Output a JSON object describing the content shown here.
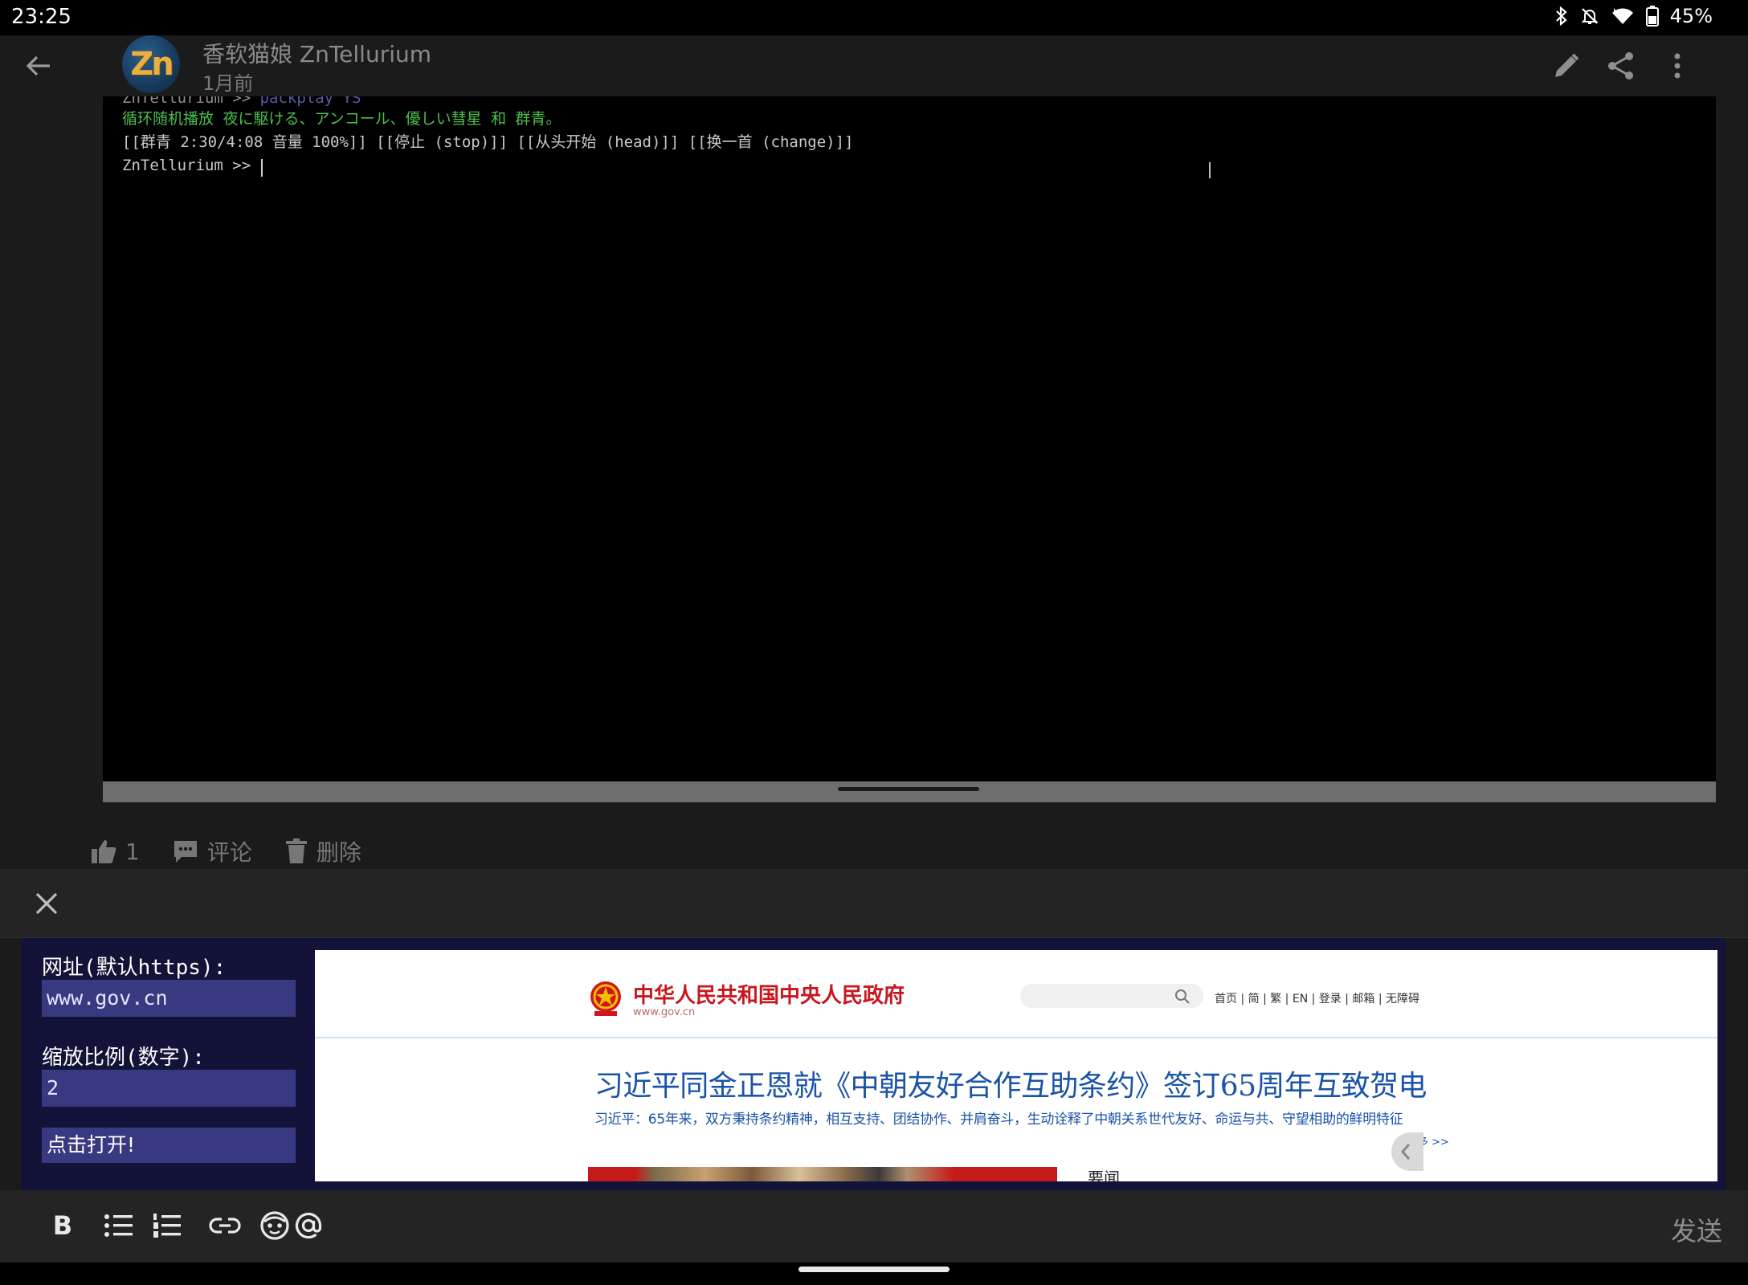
{
  "status_bar": {
    "time": "23:25",
    "battery": "45%",
    "icons": [
      "bluetooth-icon",
      "notifications-off-icon",
      "wifi-icon",
      "battery-icon"
    ]
  },
  "post": {
    "author": "香软猫娘 ZnTellurium",
    "time": "1月前",
    "avatar_text": "Zn",
    "like_count": "1",
    "comment_label": "评论",
    "delete_label": "删除"
  },
  "terminal": {
    "line_0_prompt": "ZnTellurium >> ",
    "line_0_cmd": "packplay YS",
    "line_1": "循环随机播放 夜に駆ける、アンコール、優しい彗星 和 群青。",
    "line_2": "[[群青 2:30/4:08 音量 100%]] [[停止 (stop)]] [[从头开始 (head)]] [[换一首 (change)]]",
    "line_3": "ZnTellurium >> "
  },
  "widget": {
    "url_label": "网址(默认https):",
    "url_value": "www.gov.cn",
    "zoom_label": "缩放比例(数字):",
    "zoom_value": "2",
    "open_label": "点击打开!"
  },
  "webview": {
    "site_name": "中华人民共和国中央人民政府",
    "site_domain": "www.gov.cn",
    "nav": "首页 | 简 | 繁 | EN | 登录 | 邮箱 | 无障碍",
    "headline": "习近平同金正恩就《中朝友好合作互助条约》签订65周年互致贺电",
    "subline": "习近平：65年来，双方秉持条约精神，相互支持、团结协作、并肩奋斗，生动诠释了中朝关系世代友好、命运与共、守望相助的鲜明特征",
    "more": "更多 >>",
    "section": "要闻"
  },
  "toolbar": {
    "bold": "B",
    "send": "发送"
  },
  "colors": {
    "terminal_bg": "#000000",
    "widget_bg": "#131339",
    "input_bg": "#393982",
    "gov_red": "#c8171e",
    "gov_blue": "#1a53a8"
  }
}
